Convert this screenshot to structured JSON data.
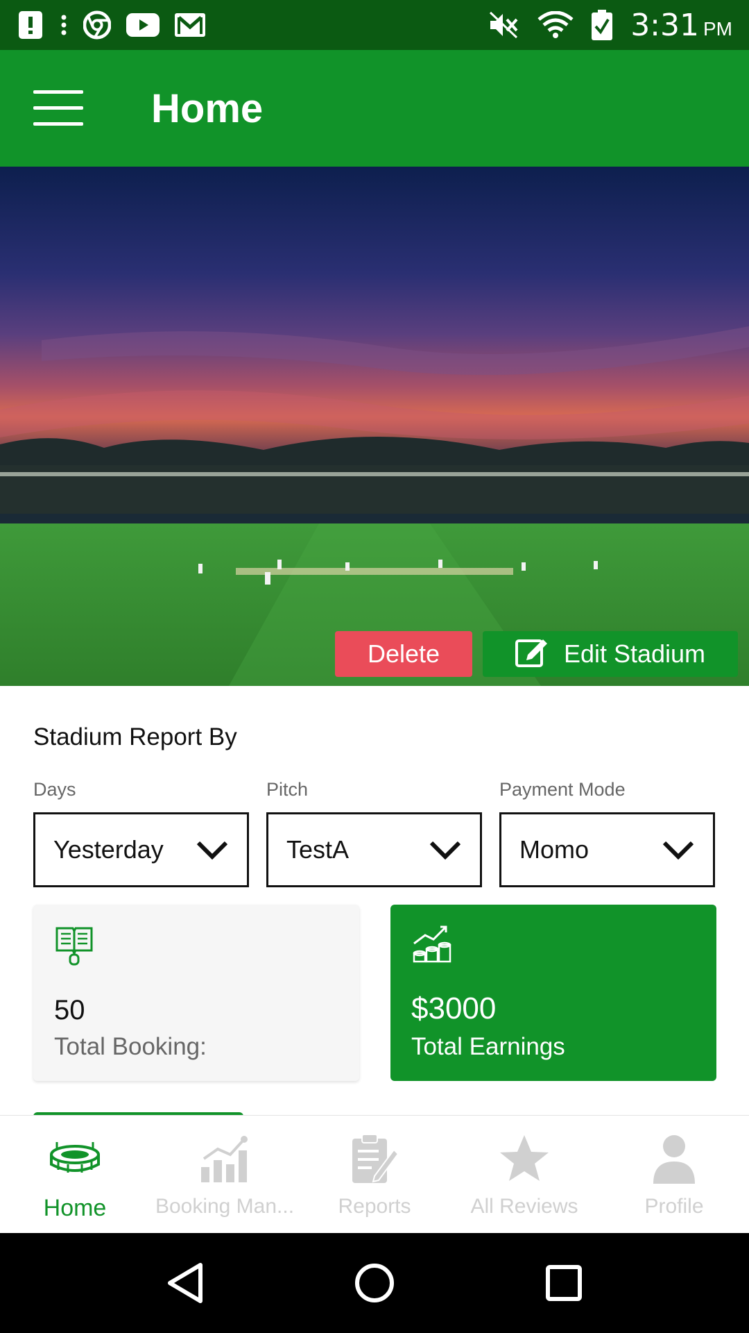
{
  "status_bar": {
    "time": "3:31",
    "ampm": "PM",
    "left_icons": [
      "alert-icon",
      "more-vert-icon",
      "chrome-icon",
      "youtube-icon",
      "gmail-icon"
    ],
    "right_icons": [
      "mute-icon",
      "wifi-icon",
      "battery-icon"
    ]
  },
  "app_bar": {
    "title": "Home"
  },
  "hero": {
    "delete_label": "Delete",
    "edit_label": "Edit Stadium"
  },
  "report": {
    "title": "Stadium Report By",
    "filters": [
      {
        "label": "Days",
        "value": "Yesterday"
      },
      {
        "label": "Pitch",
        "value": "TestA"
      },
      {
        "label": "Payment Mode",
        "value": "Momo"
      }
    ]
  },
  "cards": {
    "booking": {
      "value": "50",
      "label": "Total Booking:"
    },
    "earnings": {
      "value": "$3000",
      "label": "Total Earnings"
    }
  },
  "bottom_nav": {
    "items": [
      {
        "label": "Home",
        "icon": "stadium-icon",
        "active": true
      },
      {
        "label": "Booking Man...",
        "icon": "bar-chart-icon",
        "active": false
      },
      {
        "label": "Reports",
        "icon": "clipboard-icon",
        "active": false
      },
      {
        "label": "All Reviews",
        "icon": "star-icon",
        "active": false
      },
      {
        "label": "Profile",
        "icon": "person-icon",
        "active": false
      }
    ]
  },
  "colors": {
    "primary": "#119329",
    "status_bar": "#0b5a12",
    "delete": "#ea4c59",
    "inactive": "#d0d0d0"
  }
}
